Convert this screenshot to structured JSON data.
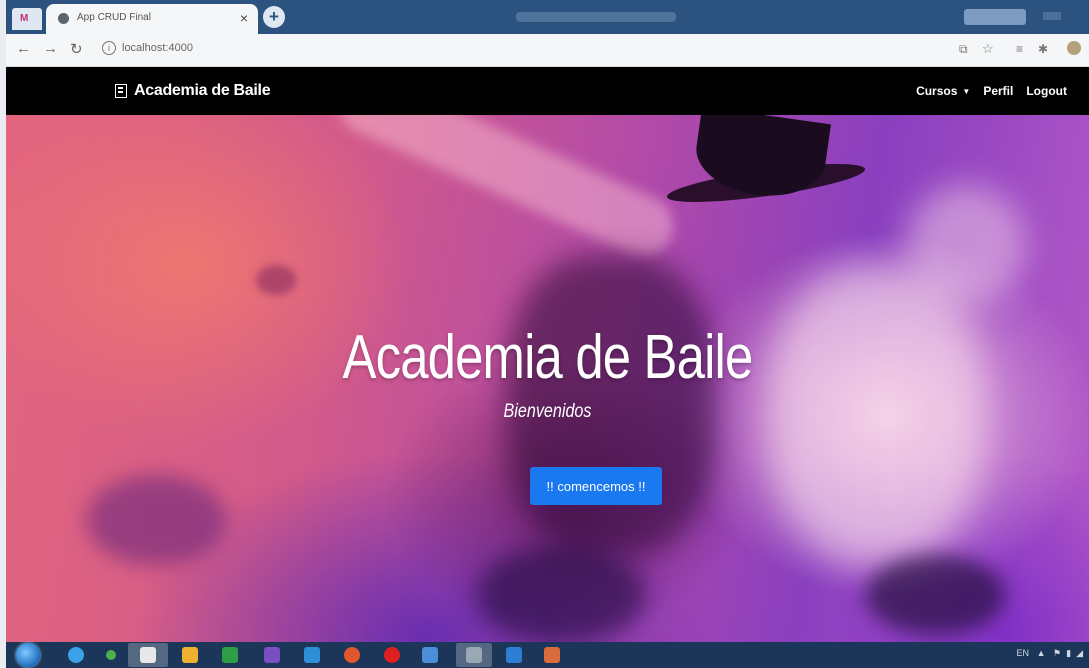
{
  "browser": {
    "tab_title": "App CRUD Final",
    "url": "localhost:4000",
    "tab_close": "×",
    "new_tab": "+"
  },
  "site": {
    "brand": "Academia de Baile",
    "nav": {
      "cursos": "Cursos",
      "perfil": "Perfil",
      "logout": "Logout"
    }
  },
  "hero": {
    "title": "Academia de Baile",
    "subtitle": "Bienvenidos",
    "cta_label": "!! comencemos !!"
  },
  "taskbar": {
    "lang": "EN"
  },
  "colors": {
    "navbar": "#000000",
    "cta": "#1a78f0",
    "tabstrip": "#2c5380"
  }
}
